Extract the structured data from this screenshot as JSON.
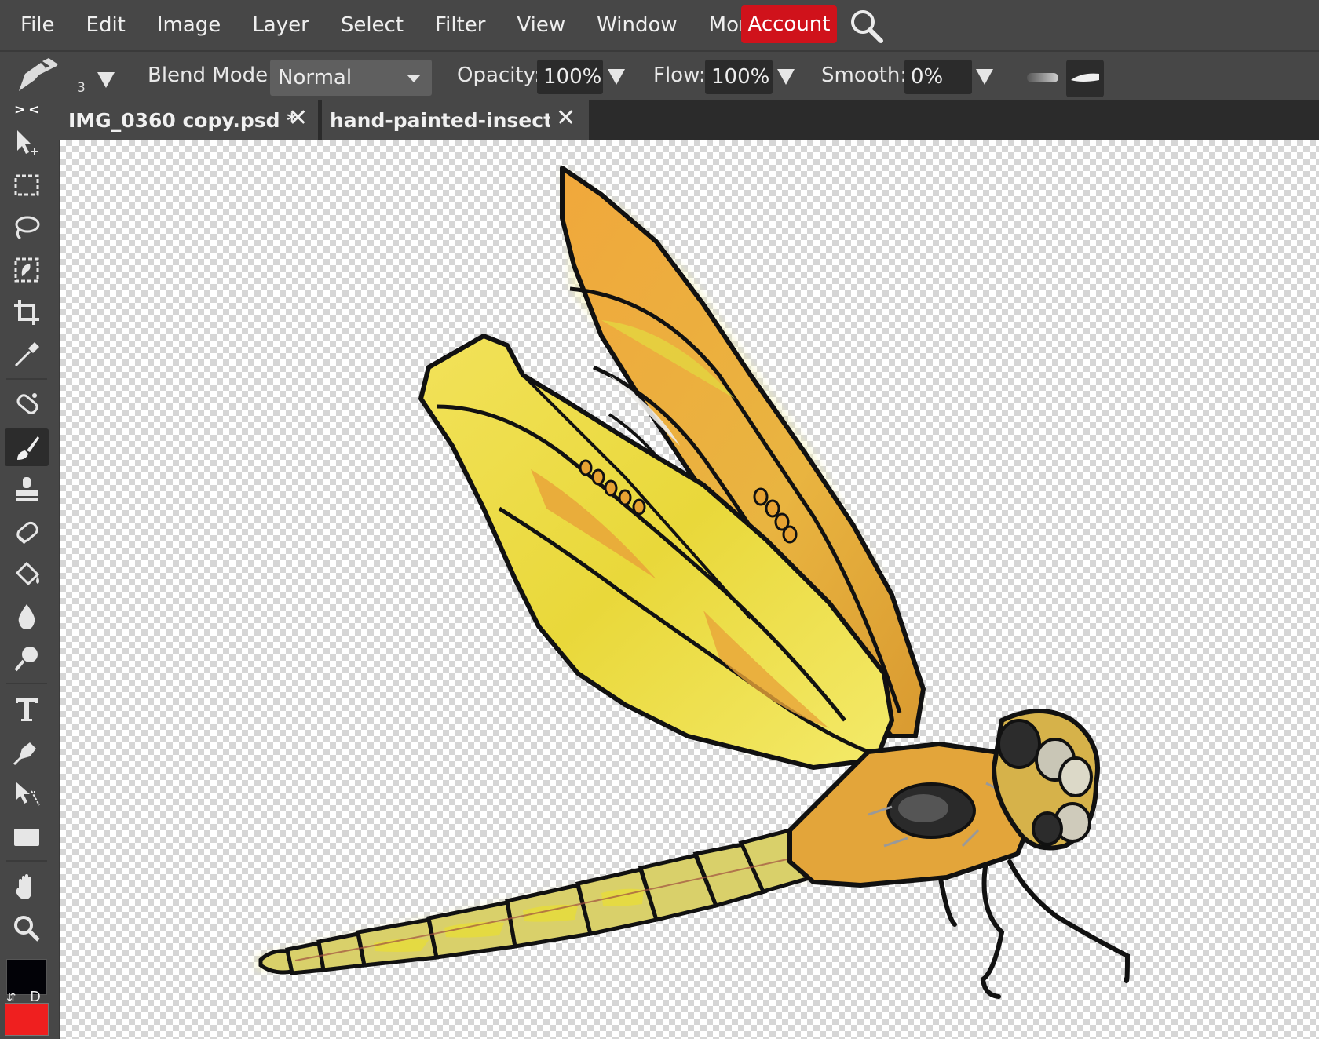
{
  "menu": {
    "items": [
      "File",
      "Edit",
      "Image",
      "Layer",
      "Select",
      "Filter",
      "View",
      "Window",
      "More"
    ],
    "account": "Account",
    "search_icon": "search-icon"
  },
  "options": {
    "brush_size": "3",
    "blend_label": "Blend Mode:",
    "blend_value": "Normal",
    "opacity_label": "Opacity:",
    "opacity_value": "100%",
    "flow_label": "Flow:",
    "flow_value": "100%",
    "smooth_label": "Smooth:",
    "smooth_value": "0%"
  },
  "toolbar": {
    "collapse": "> <",
    "tools": [
      "move",
      "rect-select",
      "lasso",
      "quick-select",
      "crop",
      "eyedropper",
      "healing",
      "brush",
      "clone-stamp",
      "eraser",
      "paint-bucket",
      "blur",
      "dodge",
      "type",
      "pen",
      "path-select",
      "shape",
      "hand",
      "zoom"
    ],
    "active_tool": "brush",
    "swap_glyph": "⇵",
    "default_label": "D",
    "foreground_color": "#020207",
    "background_color": "#ef1f1f"
  },
  "tabs": [
    {
      "title": "IMG_0360 copy.psd *"
    },
    {
      "title": "hand-painted-insects"
    }
  ],
  "accent_color": "#d0121b"
}
